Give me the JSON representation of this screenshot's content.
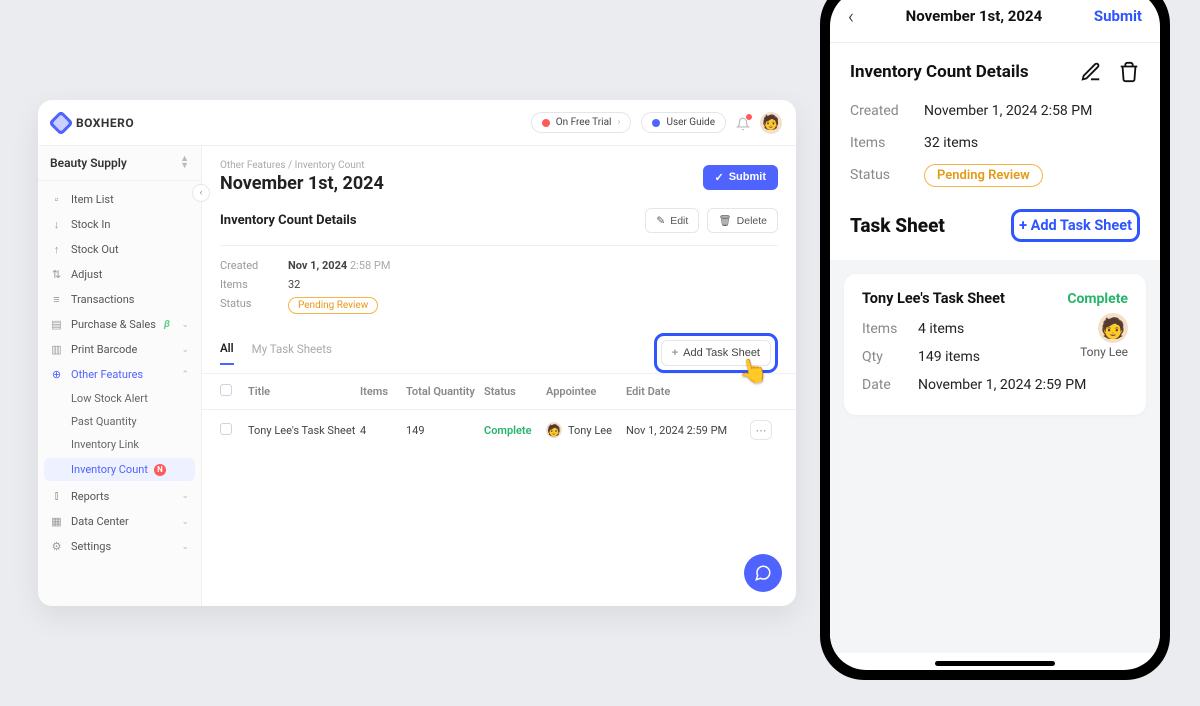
{
  "app": {
    "brand": "BOXHERO",
    "trial_pill": "On Free Trial",
    "guide_pill": "User Guide",
    "team": "Beauty Supply"
  },
  "sidebar": {
    "items": [
      {
        "label": "Item List"
      },
      {
        "label": "Stock In"
      },
      {
        "label": "Stock Out"
      },
      {
        "label": "Adjust"
      },
      {
        "label": "Transactions"
      },
      {
        "label": "Purchase & Sales"
      },
      {
        "label": "Print Barcode"
      },
      {
        "label": "Other Features"
      },
      {
        "label": "Reports"
      },
      {
        "label": "Data Center"
      },
      {
        "label": "Settings"
      }
    ],
    "subs": {
      "other": [
        {
          "label": "Low Stock Alert"
        },
        {
          "label": "Past Quantity"
        },
        {
          "label": "Inventory Link"
        },
        {
          "label": "Inventory Count"
        }
      ]
    },
    "badge_new": "N"
  },
  "breadcrumb": {
    "a": "Other Features",
    "b": "Inventory Count"
  },
  "page": {
    "title": "November 1st, 2024",
    "submit": "Submit",
    "details_title": "Inventory Count Details",
    "edit": "Edit",
    "delete": "Delete",
    "created_k": "Created",
    "created_v": "Nov 1, 2024",
    "created_t": "2:58 PM",
    "items_k": "Items",
    "items_v": "32",
    "status_k": "Status",
    "status_v": "Pending Review"
  },
  "tabs": {
    "all": "All",
    "my": "My Task Sheets",
    "add": "Add Task Sheet"
  },
  "table": {
    "h": {
      "title": "Title",
      "items": "Items",
      "tq": "Total Quantity",
      "status": "Status",
      "ap": "Appointee",
      "dt": "Edit Date"
    },
    "rows": [
      {
        "title": "Tony Lee's Task Sheet",
        "items": "4",
        "tq": "149",
        "status": "Complete",
        "ap": "Tony Lee",
        "dt": "Nov 1, 2024 2:59 PM"
      }
    ]
  },
  "mobile": {
    "title": "November 1st, 2024",
    "submit": "Submit",
    "sec_title": "Inventory Count Details",
    "created_k": "Created",
    "created_v": "November 1, 2024 2:58 PM",
    "items_k": "Items",
    "items_v": "32 items",
    "status_k": "Status",
    "status_v": "Pending Review",
    "ts_title": "Task Sheet",
    "ts_add": "+ Add Task Sheet",
    "card": {
      "title": "Tony Lee's Task Sheet",
      "complete": "Complete",
      "items_k": "Items",
      "items_v": "4 items",
      "qty_k": "Qty",
      "qty_v": "149 items",
      "date_k": "Date",
      "date_v": "November 1, 2024 2:59 PM",
      "user": "Tony Lee"
    }
  }
}
